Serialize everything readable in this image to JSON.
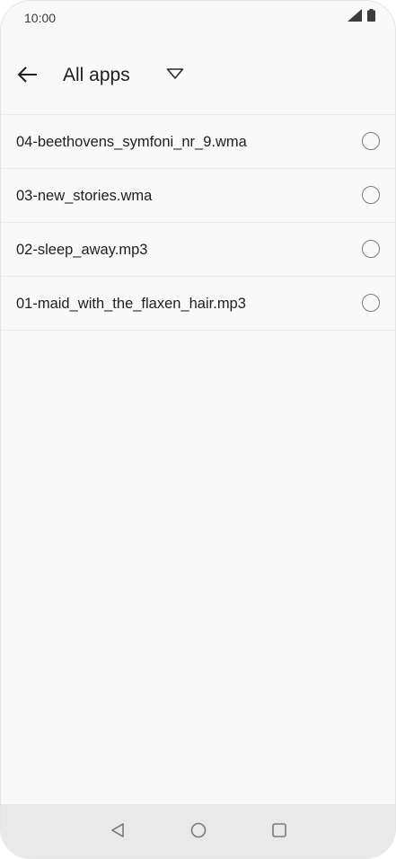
{
  "status_bar": {
    "time": "10:00",
    "icons": [
      "signal-icon",
      "battery-icon"
    ]
  },
  "app_bar": {
    "title": "All apps",
    "back_icon": "back-arrow-icon",
    "dropdown_icon": "dropdown-triangle-icon"
  },
  "files": [
    {
      "name": "04-beethovens_symfoni_nr_9.wma",
      "selected": false
    },
    {
      "name": "03-new_stories.wma",
      "selected": false
    },
    {
      "name": "02-sleep_away.mp3",
      "selected": false
    },
    {
      "name": "01-maid_with_the_flaxen_hair.mp3",
      "selected": false
    }
  ],
  "nav_bar": {
    "buttons": [
      "nav-back-icon",
      "nav-home-icon",
      "nav-recents-icon"
    ]
  },
  "colors": {
    "background": "#f9f9f9",
    "nav_background": "#e9e9e9",
    "divider": "#ececec",
    "text": "#1f1f1f"
  }
}
